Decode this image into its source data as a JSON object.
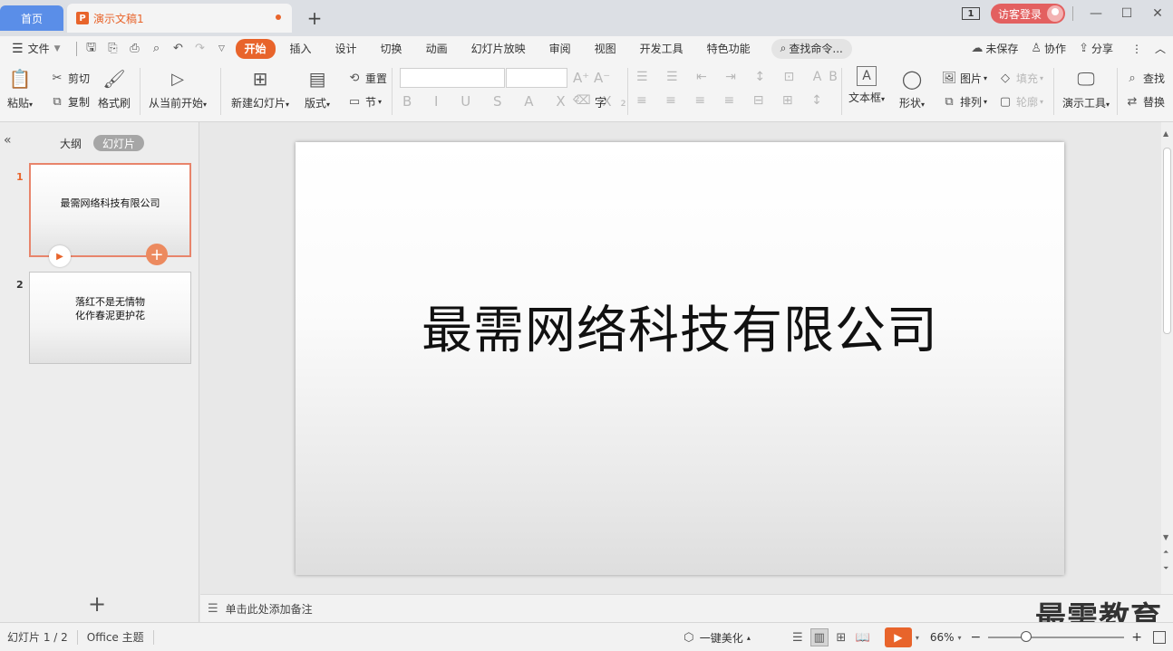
{
  "tabs": {
    "home": "首页",
    "doc": "演示文稿1",
    "doc_icon": "P",
    "add": "+"
  },
  "window": {
    "box_count": "1",
    "login": "访客登录",
    "min": "—",
    "max": "☐",
    "close": "✕"
  },
  "menu": {
    "file": "文件",
    "items": [
      "开始",
      "插入",
      "设计",
      "切换",
      "动画",
      "幻灯片放映",
      "审阅",
      "视图",
      "开发工具",
      "特色功能"
    ],
    "search": "查找命令...",
    "unsaved": "未保存",
    "collab": "协作",
    "share": "分享"
  },
  "ribbon": {
    "paste": "粘贴",
    "cut": "剪切",
    "copy": "复制",
    "format_painter": "格式刷",
    "from_current": "从当前开始",
    "new_slide": "新建幻灯片",
    "layout": "版式",
    "reset": "重置",
    "section": "节",
    "textbox": "文本框",
    "shape": "形状",
    "picture": "图片",
    "arrange": "排列",
    "fill": "填充",
    "outline": "轮廓",
    "present_tools": "演示工具",
    "find": "查找",
    "replace": "替换"
  },
  "panel": {
    "outline_tab": "大纲",
    "slides_tab": "幻灯片",
    "slides": [
      {
        "num": "1",
        "text": "最需网络科技有限公司"
      },
      {
        "num": "2",
        "line1": "落红不是无情物",
        "line2": "化作春泥更护花"
      }
    ]
  },
  "slide": {
    "title": "最需网络科技有限公司"
  },
  "notes": {
    "placeholder": "单击此处添加备注"
  },
  "status": {
    "slide_count": "幻灯片 1 / 2",
    "theme": "Office 主题",
    "beautify": "一键美化",
    "zoom": "66%"
  },
  "watermark": "最需教育",
  "colors": {
    "accent": "#e8642b",
    "home_tab": "#5a8ee8",
    "login": "#e36060"
  }
}
